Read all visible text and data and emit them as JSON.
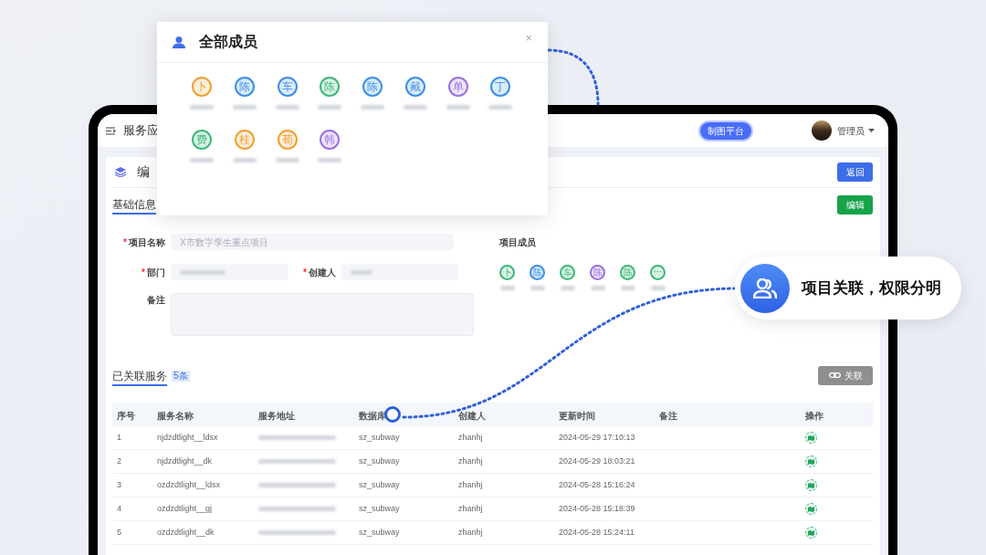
{
  "header": {
    "title": "服务应",
    "platform_badge": "制图平台",
    "user": "管理员"
  },
  "page": {
    "title": "编",
    "back_button": "返回"
  },
  "basic_info": {
    "heading": "基础信息",
    "edit_button": "编辑",
    "fields": [
      {
        "kind": "wide",
        "label": "项目名称",
        "required": true,
        "value": "X市数字孪生重点项目"
      },
      {
        "kind": "half",
        "label": "部门",
        "required": true
      },
      {
        "kind": "half",
        "label": "创建人",
        "required": true
      },
      {
        "kind": "textarea",
        "label": "备注",
        "required": false
      }
    ],
    "required_mark": "*",
    "members_label": "项目成员",
    "members": [
      {
        "kind": "person",
        "char": "卜",
        "color": "#3cb878"
      },
      {
        "kind": "person",
        "char": "陈",
        "color": "#3a8ee6"
      },
      {
        "kind": "person",
        "char": "车",
        "color": "#3cb878"
      },
      {
        "kind": "person",
        "char": "陈",
        "color": "#9b6fe0"
      },
      {
        "kind": "person",
        "char": "陈",
        "color": "#3cb878"
      },
      {
        "kind": "more",
        "char": "···",
        "color": "#3cb878"
      }
    ]
  },
  "services": {
    "heading": "已关联服务",
    "count": "5条",
    "link_button": "关联",
    "columns": [
      "序号",
      "服务名称",
      "服务地址",
      "数据库",
      "创建人",
      "更新时间",
      "备注",
      "操作"
    ],
    "rows": [
      {
        "no": "1",
        "name": "njdzdtlight__ldsx",
        "database": "sz_subway",
        "creator": "zhanhj",
        "updated": "2024-05-29 17:10:13"
      },
      {
        "no": "2",
        "name": "njdzdtlight__dk",
        "database": "sz_subway",
        "creator": "zhanhj",
        "updated": "2024-05-29 18:03:21"
      },
      {
        "no": "3",
        "name": "ozdzdtlight__ldsx",
        "database": "sz_subway",
        "creator": "zhanhj",
        "updated": "2024-05-28 15:16:24"
      },
      {
        "no": "4",
        "name": "ozdzdtlight__gj",
        "database": "sz_subway",
        "creator": "zhanhj",
        "updated": "2024-05-28 15:18:39"
      },
      {
        "no": "5",
        "name": "ozdzdtlight__dk",
        "database": "sz_subway",
        "creator": "zhanhj",
        "updated": "2024-05-28 15:24:11"
      }
    ]
  },
  "popup": {
    "title": "全部成员",
    "close": "×",
    "members": [
      {
        "char": "卜",
        "color": "#f0a030"
      },
      {
        "char": "陈",
        "color": "#3a8ee6"
      },
      {
        "char": "车",
        "color": "#3a8ee6"
      },
      {
        "char": "陈",
        "color": "#3cb878"
      },
      {
        "char": "陈",
        "color": "#3a8ee6"
      },
      {
        "char": "戴",
        "color": "#3a8ee6"
      },
      {
        "char": "单",
        "color": "#9b6fe0"
      },
      {
        "char": "丁",
        "color": "#3a8ee6"
      },
      {
        "char": "费",
        "color": "#3cb878"
      },
      {
        "char": "桂",
        "color": "#f0a030"
      },
      {
        "char": "荀",
        "color": "#f0a030"
      },
      {
        "char": "韩",
        "color": "#9b6fe0"
      }
    ]
  },
  "callout": {
    "text": "项目关联，权限分明"
  }
}
